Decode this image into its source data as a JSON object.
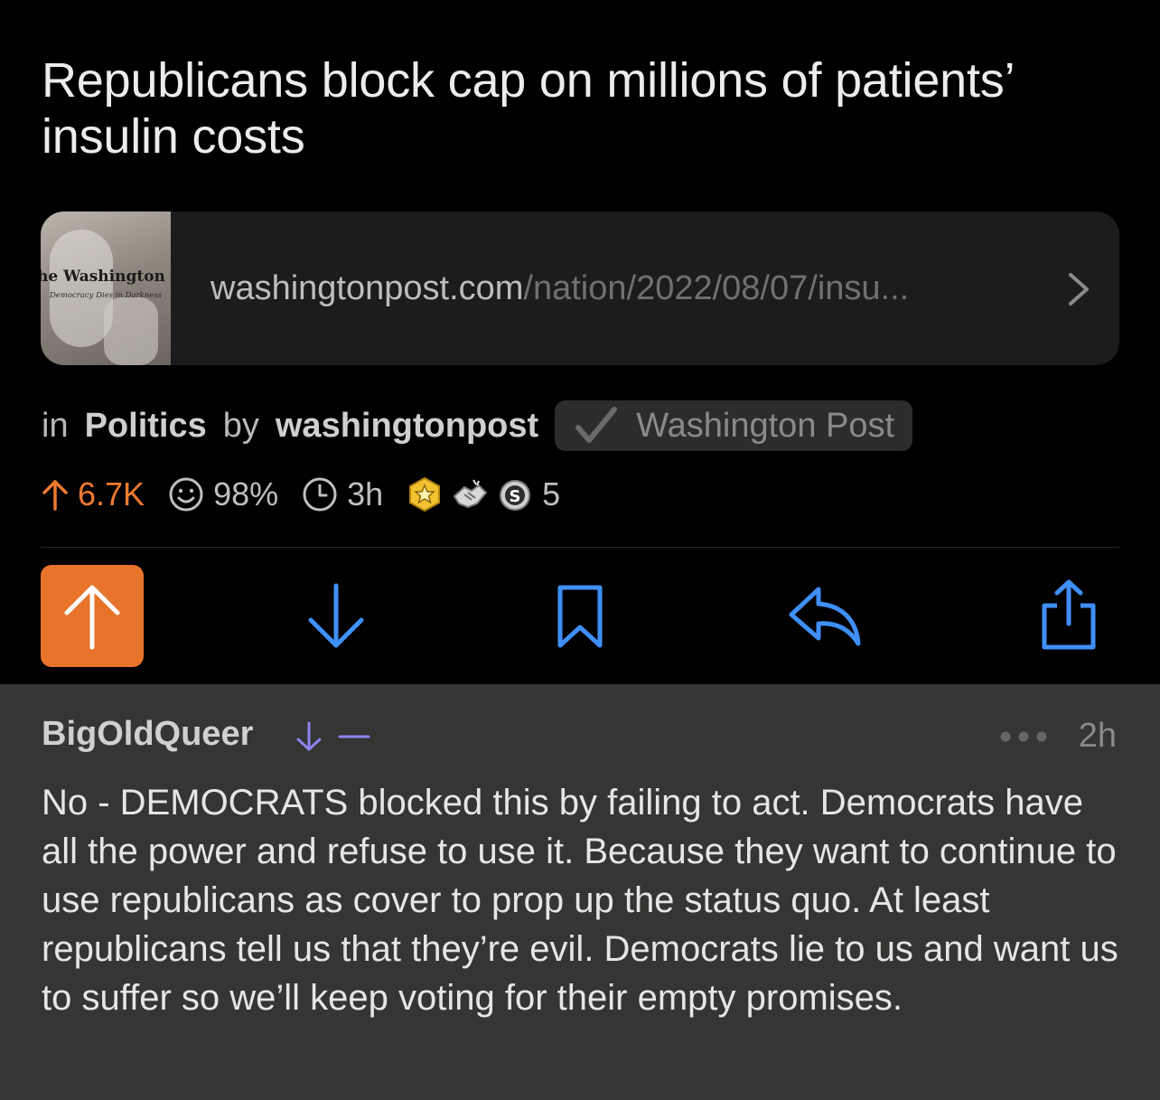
{
  "post": {
    "title": "Republicans block cap on millions of patients’ insulin costs",
    "link": {
      "thumb_masthead": "he Washington Pos",
      "thumb_slogan": "Democracy Dies in Darkness",
      "domain": "washingtonpost.com",
      "path": "/nation/2022/08/07/insu..."
    },
    "meta": {
      "in_label": "in",
      "subreddit": "Politics",
      "by_label": "by",
      "author": "washingtonpost",
      "flair": "Washington Post"
    },
    "stats": {
      "score": "6.7K",
      "upvote_ratio": "98%",
      "age": "3h",
      "awards_count": "5"
    }
  },
  "colors": {
    "accent_orange": "#e8732a",
    "action_blue": "#3f8ff7",
    "downvote_purple": "#8d84f0"
  },
  "icons": {
    "score": "arrow-up-icon",
    "ratio": "smiley-icon",
    "age": "clock-icon",
    "awards": [
      "gold-star-award-icon",
      "handshake-award-icon",
      "silver-award-icon"
    ],
    "actions": [
      "upvote-icon",
      "downvote-icon",
      "bookmark-icon",
      "reply-icon",
      "share-icon"
    ]
  },
  "comment": {
    "author": "BigOldQueer",
    "score": "—",
    "time": "2h",
    "body": "No - DEMOCRATS blocked this by failing to act. Democrats have all the power and refuse to use it. Because they want to continue to use republicans as cover to prop up the status quo. At least republicans tell us that they’re evil. Democrats lie to us and want us to suffer so we’ll keep voting for their empty promises."
  }
}
